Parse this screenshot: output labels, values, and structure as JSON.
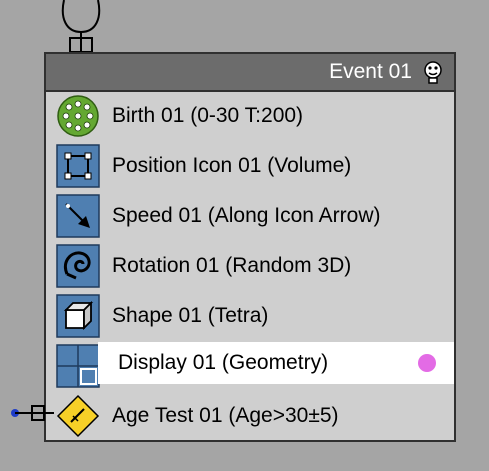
{
  "event": {
    "title": "Event 01",
    "title_icon": "lightbulb-icon"
  },
  "operators": [
    {
      "label": "Birth 01 (0-30 T:200)",
      "icon": "birth-icon"
    },
    {
      "label": "Position Icon 01 (Volume)",
      "icon": "position-icon"
    },
    {
      "label": "Speed 01 (Along Icon Arrow)",
      "icon": "speed-icon"
    },
    {
      "label": "Rotation 01 (Random 3D)",
      "icon": "rotation-icon"
    },
    {
      "label": "Shape 01 (Tetra)",
      "icon": "shape-icon"
    },
    {
      "label": "Display 01 (Geometry)",
      "icon": "display-icon",
      "selected": true,
      "display_color": "#e36be5"
    },
    {
      "label": "Age Test 01 (Age>30±5)",
      "icon": "age-test-icon"
    }
  ],
  "colors": {
    "background": "#a5a5a5",
    "event_body": "#cfcfcf",
    "event_header": "#6c6c6c",
    "operator_icon": "#4f7fb1",
    "birth_icon": "#64a832",
    "test_icon": "#f7d027",
    "output_port": "#1e3cc8"
  }
}
